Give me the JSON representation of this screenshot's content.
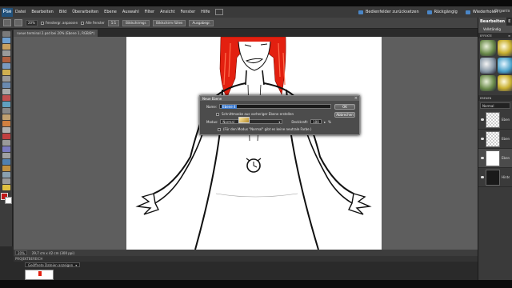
{
  "app": {
    "logo": "Pse"
  },
  "menu": [
    "Datei",
    "Bearbeiten",
    "Bild",
    "Überarbeiten",
    "Ebene",
    "Auswahl",
    "Filter",
    "Ansicht",
    "Fenster",
    "Hilfe"
  ],
  "commands": {
    "reset": "Bedienfelder zurücksetzen",
    "undo": "Rückgängig",
    "redo": "Wiederholen"
  },
  "options": {
    "zoom": "20%",
    "resize_windows": "Fenstergr. anpassen",
    "all_windows": "Alle Fenster",
    "one_to_one": "1:1",
    "fit_screen": "Bildschirmgr.",
    "fill_screen": "Bildschirm füllen",
    "print_size": "Ausgabegr."
  },
  "document": {
    "tab": "rueue terminal 2.psd bei 20% (Ebene 1, RGB/8*)",
    "status_zoom": "20%",
    "status_size": "29,7 cm x 42 cm (300 ppi)"
  },
  "project_bin": {
    "title": "PROJEKTBEREICH",
    "filter": "Geöffnete Dateien anzeigen"
  },
  "right_panel": {
    "tab_active": "Bearbeiten",
    "tab_other": "E",
    "tab_org": "Organis",
    "mode": "Vollständig",
    "effects_title": "EFFEKTE",
    "layers_title": "EBENEN",
    "blend_mode": "Normal",
    "layers": [
      {
        "name": "Ebene",
        "thumb": "checker"
      },
      {
        "name": "Ebene",
        "thumb": "checker"
      },
      {
        "name": "Ebene 1",
        "thumb": "white"
      },
      {
        "name": "Hintergr",
        "thumb": "dark"
      }
    ]
  },
  "dialog": {
    "title": "Neue Ebene",
    "name_label": "Name:",
    "name_value": "Ebene 4",
    "clip_label": "Schnittmaske aus vorheriger Ebene erstellen",
    "mode_label": "Modus:",
    "mode_value": "Normal",
    "opacity_label": "Deckkraft:",
    "opacity_value": "100",
    "opacity_unit": "%",
    "neutral_label": "(Für den Modus \"Normal\" gibt es keine neutrale Farbe.)",
    "ok": "OK",
    "cancel": "Abbrechen"
  },
  "colors": {
    "hair": "#e32010",
    "accent": "#3c7bd0"
  }
}
